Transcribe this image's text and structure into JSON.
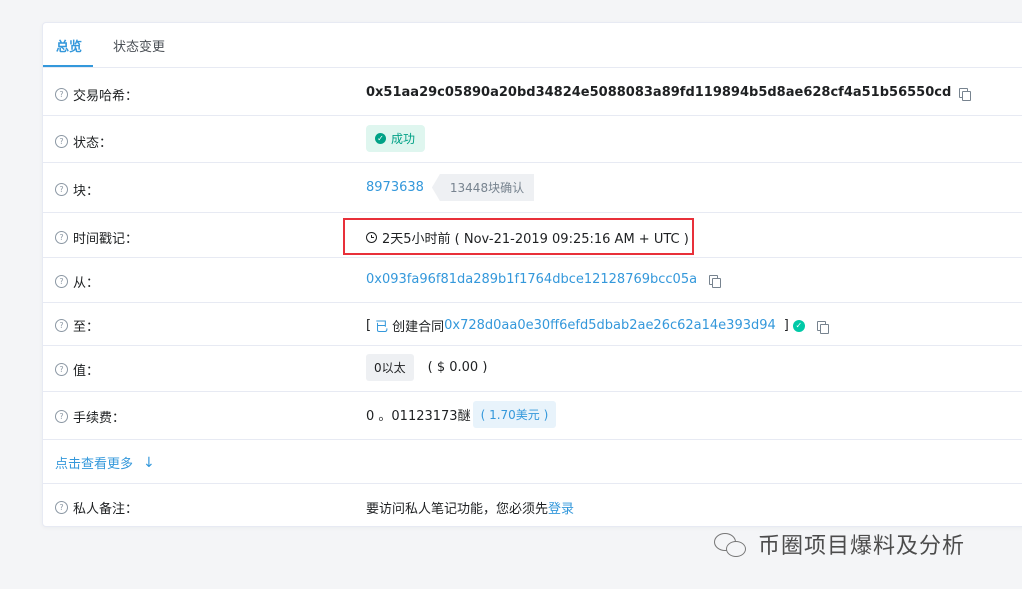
{
  "tabs": [
    {
      "label": "总览"
    },
    {
      "label": "状态变更"
    }
  ],
  "rows": {
    "txhash": {
      "label": "交易哈希：",
      "value": "0x51aa29c05890a20bd34824e5088083a89fd119894b5d8ae628cf4a51b56550cd"
    },
    "status": {
      "label": "状态：",
      "value": "成功"
    },
    "block": {
      "label": "块：",
      "number": "8973638",
      "confirmations": "13448块确认"
    },
    "timestamp": {
      "label": "时间戳记：",
      "value": "2天5小时前 ( Nov-21-2019 09:25:16 AM + UTC )"
    },
    "from": {
      "label": "从：",
      "value": "0x093fa96f81da289b1f1764dbce12128769bcc05a"
    },
    "to": {
      "label": "至：",
      "prefix": "[",
      "created": "已",
      "text": "创建合同",
      "address": "0x728d0aa0e30ff6efd5dbab2ae26c62a14e393d94",
      "suffix": "]"
    },
    "value": {
      "label": "值：",
      "amount": "0以太",
      "usd": "( $ 0.00 )"
    },
    "fee": {
      "label": "手续费：",
      "amount": "0 。01123173醚",
      "usd": "( 1.70美元 )"
    },
    "more": {
      "label": "点击查看更多"
    },
    "note": {
      "label": "私人备注：",
      "text": "要访问私人笔记功能，您必须先",
      "login": "登录"
    }
  },
  "watermark": {
    "text": "币圈项目爆料及分析"
  },
  "colors": {
    "link": "#3498db",
    "success": "#00a186",
    "highlight": "#e8303a"
  }
}
